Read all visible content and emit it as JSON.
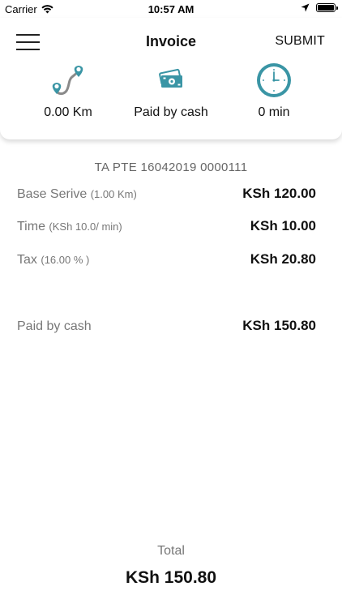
{
  "status_bar": {
    "carrier": "Carrier",
    "time": "10:57 AM"
  },
  "header": {
    "title": "Invoice",
    "submit_label": "SUBMIT"
  },
  "stats": {
    "distance": "0.00 Km",
    "payment": "Paid by cash",
    "duration": "0 min"
  },
  "invoice": {
    "reference": "TA PTE 16042019 0000111",
    "rows": [
      {
        "label": "Base Serive",
        "detail": "(1.00 Km)",
        "amount": "KSh 120.00"
      },
      {
        "label": "Time",
        "detail": "(KSh 10.0/ min)",
        "amount": "KSh 10.00"
      },
      {
        "label": "Tax",
        "detail": "(16.00 % )",
        "amount": "KSh 20.80"
      }
    ],
    "paid": {
      "label": "Paid by cash",
      "amount": "KSh 150.80"
    }
  },
  "total": {
    "label": "Total",
    "amount": "KSh 150.80"
  },
  "colors": {
    "accent_teal": "#3a95a5",
    "icon_gray": "#8a8a8a",
    "label_gray": "#777777"
  },
  "icons": {
    "distance": "route-pin-icon",
    "payment": "cash-icon",
    "duration": "clock-icon"
  }
}
